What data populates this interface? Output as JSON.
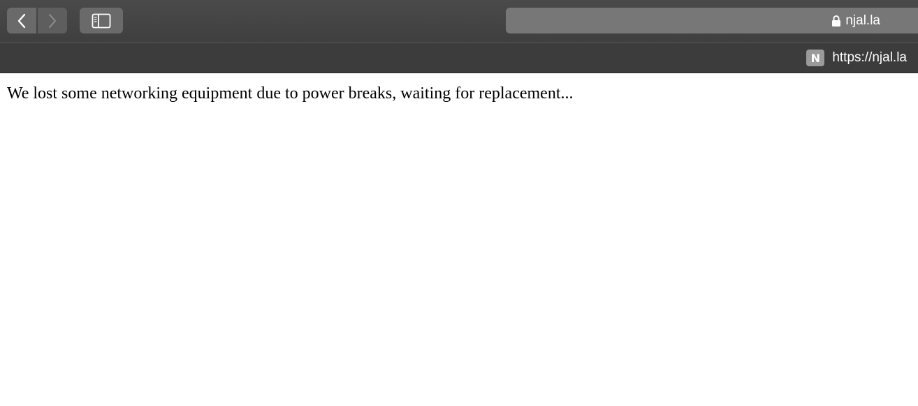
{
  "toolbar": {
    "address": "njal.la",
    "icons": {
      "back": "chevron-left-icon",
      "forward": "chevron-right-icon",
      "sidebar": "sidebar-icon",
      "lock": "lock-icon"
    }
  },
  "tab": {
    "favicon_letter": "N",
    "title": "https://njal.la"
  },
  "page": {
    "message": "We lost some networking equipment due to power breaks, waiting for replacement..."
  }
}
